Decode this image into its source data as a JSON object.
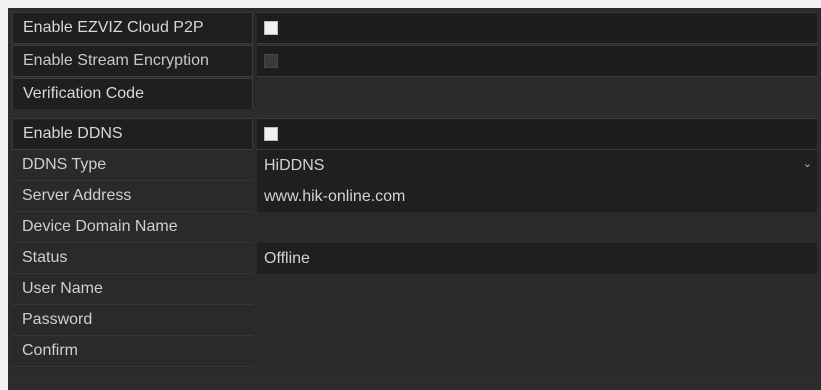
{
  "p2p_section": {
    "rows": [
      {
        "label": "Enable EZVIZ Cloud P2P",
        "control": "checkbox",
        "checked": false,
        "enabled": true
      },
      {
        "label": "Enable Stream Encryption",
        "control": "checkbox",
        "checked": false,
        "enabled": false
      },
      {
        "label": "Verification Code",
        "value": ""
      }
    ]
  },
  "ddns_section": {
    "enable_label": "Enable DDNS",
    "enable_checked": false,
    "type_label": "DDNS Type",
    "type_value": "HiDDNS",
    "server_label": "Server Address",
    "server_value": "www.hik-online.com",
    "domain_label": "Device Domain Name",
    "domain_value": "",
    "status_label": "Status",
    "status_value": "Offline",
    "username_label": "User Name",
    "username_value": "",
    "password_label": "Password",
    "password_value": "",
    "confirm_label": "Confirm",
    "confirm_value": ""
  },
  "icons": {
    "dropdown": "chevron-down-icon"
  },
  "colors": {
    "panel_bg": "#2c2c2c",
    "field_bg": "#1d1d1d",
    "text": "#d2d2d2",
    "checkbox": "#f1f1f1"
  }
}
